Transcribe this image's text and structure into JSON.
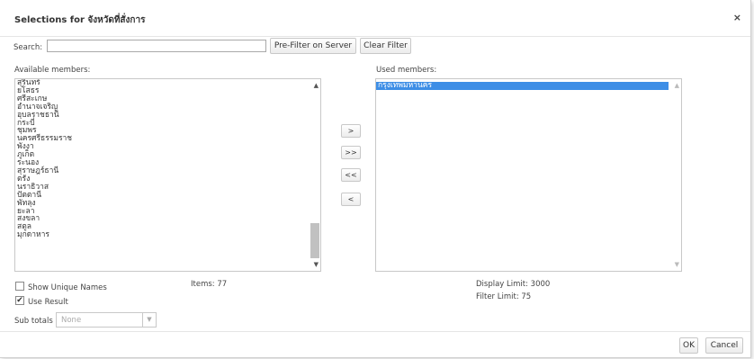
{
  "dialog": {
    "title": "Selections for จังหวัดที่สั่งการ",
    "close_glyph": "×"
  },
  "search": {
    "label": "Search:",
    "value": "",
    "prefilter_label": "Pre-Filter on Server",
    "clear_label": "Clear Filter"
  },
  "available": {
    "label": "Available members:",
    "items": [
      "สุรินทร์",
      "ยโสธร",
      "ศรีสะเกษ",
      "อำนาจเจริญ",
      "อุบลราชธานี",
      "กระบี่",
      "ชุมพร",
      "นครศรีธรรมราช",
      "พังงา",
      "ภูเก็ต",
      "ระนอง",
      "สุราษฎร์ธานี",
      "ตรัง",
      "นราธิวาส",
      "ปัตตานี",
      "พัทลุง",
      "ยะลา",
      "สงขลา",
      "สตูล",
      "มุกดาหาร"
    ],
    "items_count": "Items: 77"
  },
  "used": {
    "label": "Used members:",
    "items": [
      "กรุงเทพมหานคร"
    ]
  },
  "move_buttons": {
    "add": ">",
    "add_all": ">>",
    "remove_all": "<<",
    "remove": "<"
  },
  "options": {
    "show_unique_names": "Show Unique Names",
    "show_unique_names_checked": false,
    "use_result": "Use Result",
    "use_result_checked": true
  },
  "limits": {
    "display_limit": "Display Limit: 3000",
    "filter_limit": "Filter Limit: 75"
  },
  "subtotals": {
    "label": "Sub totals",
    "value": "None"
  },
  "footer": {
    "ok_label": "OK",
    "cancel_label": "Cancel"
  }
}
